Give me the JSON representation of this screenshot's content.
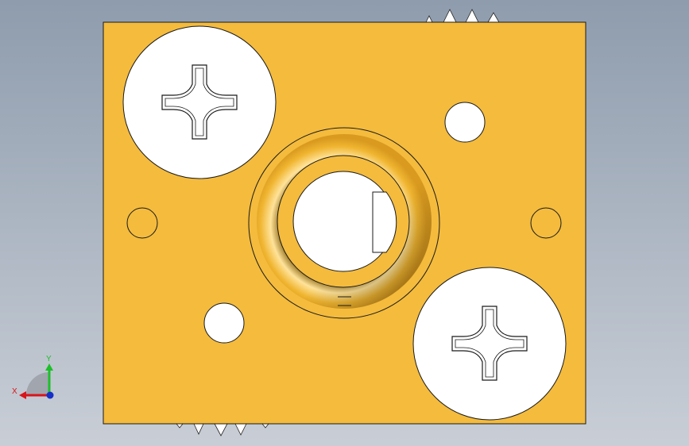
{
  "viewport": {
    "background_top": "#8e9cad",
    "background_bottom": "#c9ced6"
  },
  "part": {
    "face_color": "#f4bb3d",
    "edge_color": "#1a1a1a",
    "hole_color": "#ffffff"
  },
  "triad": {
    "x_label": "X",
    "y_label": "Y",
    "x_color": "#d9141a",
    "y_color": "#1dbf2a",
    "z_color": "#1430c8"
  },
  "icons": {
    "screw_head": "phillips-screw-head-icon",
    "boss": "raised-boss-icon",
    "gear": "gear-icon",
    "triad": "coordinate-triad-icon"
  }
}
